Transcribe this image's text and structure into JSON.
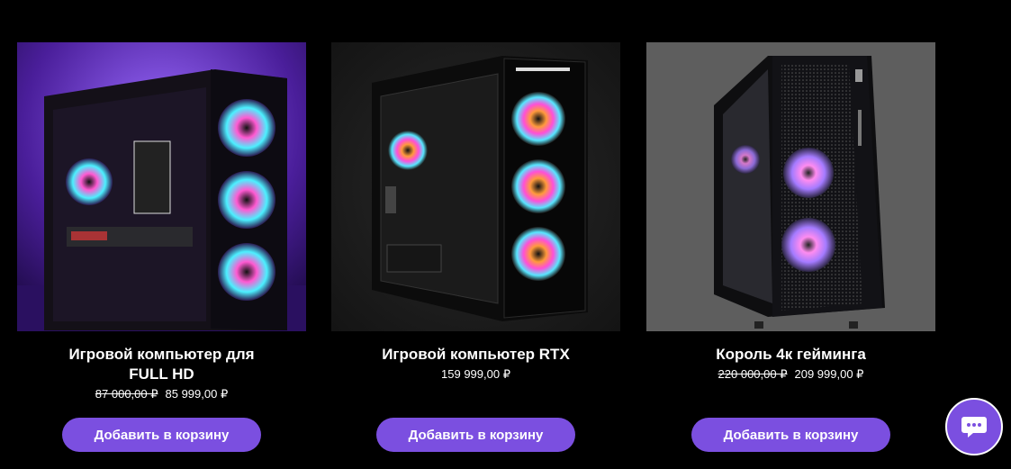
{
  "products": [
    {
      "title": "Игровой компьютер для FULL HD",
      "old_price": "87 000,00 ₽",
      "price": "85 999,00 ₽",
      "button_label": "Добавить в корзину",
      "image_icon": "gaming-pc-purple-image"
    },
    {
      "title": "Игровой компьютер RTX",
      "old_price": "",
      "price": "159 999,00 ₽",
      "button_label": "Добавить в корзину",
      "image_icon": "gaming-pc-black-image"
    },
    {
      "title": "Король 4к гейминга",
      "old_price": "220 000,00 ₽",
      "price": "209 999,00 ₽",
      "button_label": "Добавить в корзину",
      "image_icon": "gaming-pc-mesh-image"
    }
  ],
  "chat": {
    "icon": "chat-bubble-icon"
  },
  "colors": {
    "accent": "#7b4fe0",
    "background": "#000000"
  }
}
